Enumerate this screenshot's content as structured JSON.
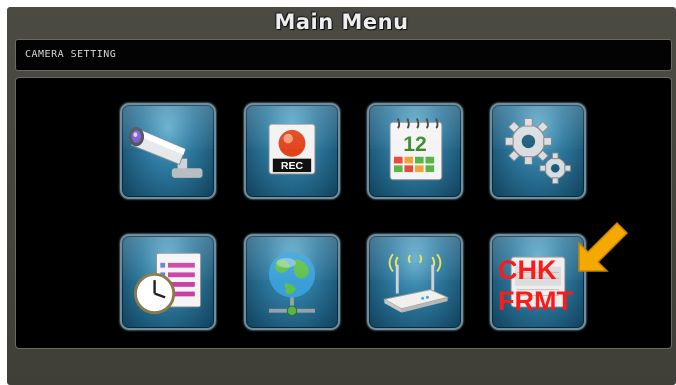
{
  "header": {
    "title": "Main Menu"
  },
  "status": {
    "text": "CAMERA SETTING"
  },
  "menu": {
    "items": [
      {
        "name": "camera",
        "icon": "security-camera-icon"
      },
      {
        "name": "record",
        "icon": "record-icon",
        "label": "REC"
      },
      {
        "name": "schedule",
        "icon": "calendar-icon",
        "label": "12"
      },
      {
        "name": "settings",
        "icon": "gears-icon"
      },
      {
        "name": "event-log",
        "icon": "clock-list-icon"
      },
      {
        "name": "network",
        "icon": "globe-network-icon"
      },
      {
        "name": "wireless",
        "icon": "wireless-router-icon"
      },
      {
        "name": "storage",
        "icon": "disk-check-format-icon"
      }
    ]
  },
  "annotation": {
    "line1": "CHK",
    "line2": "FRMT",
    "color": "#ff1a1a",
    "arrow_color": "#f5a800"
  }
}
